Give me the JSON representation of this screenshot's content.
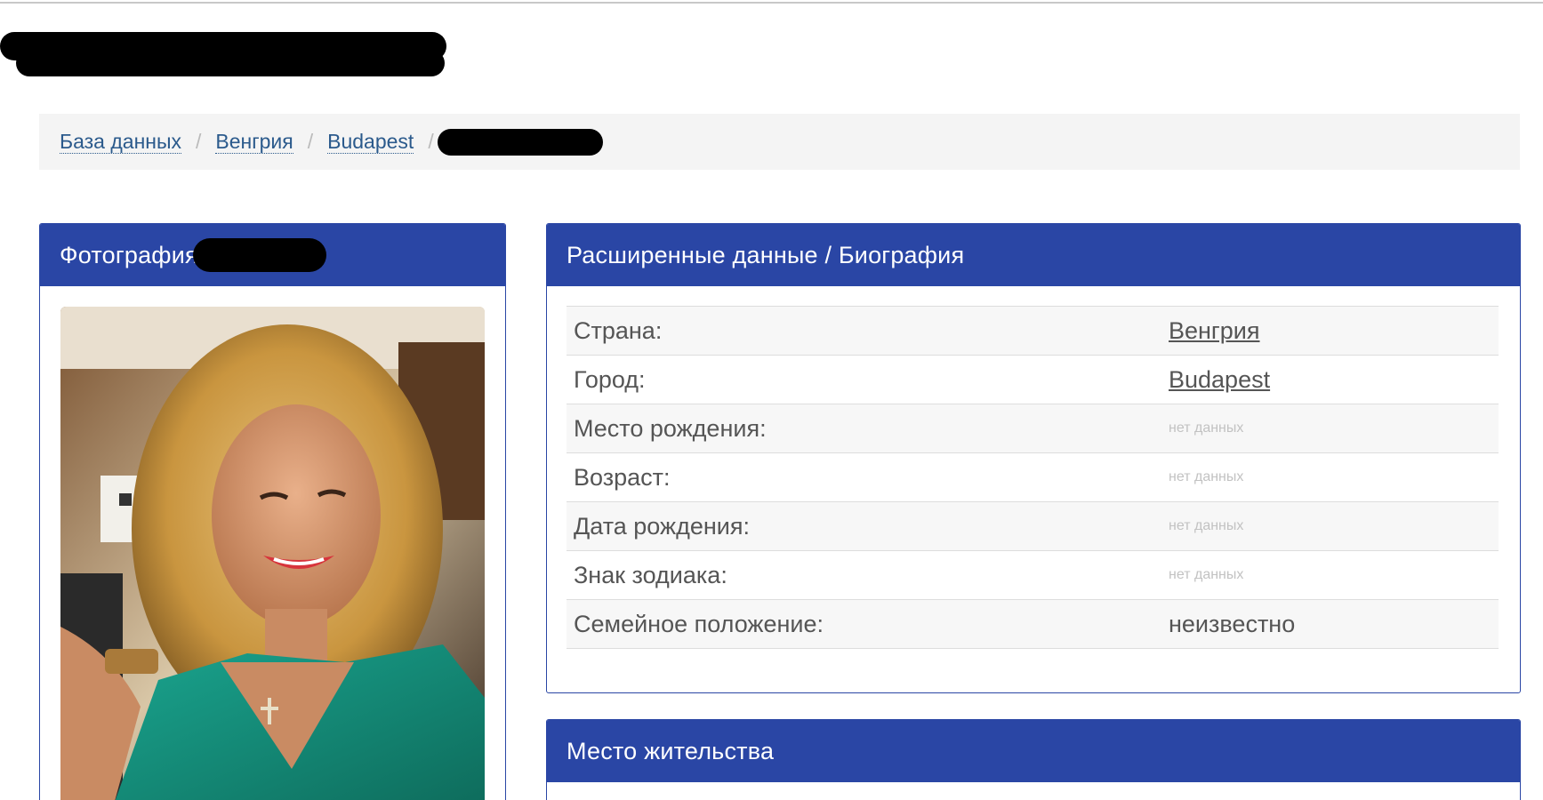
{
  "breadcrumb": {
    "items": [
      "База данных",
      "Венгрия",
      "Budapest"
    ],
    "separator": "/"
  },
  "photo_panel": {
    "title": "Фотография"
  },
  "bio_panel": {
    "title": "Расширенные данные / Биография",
    "rows": [
      {
        "label": "Страна:",
        "value": "Венгрия"
      },
      {
        "label": "Город:",
        "value": "Budapest"
      },
      {
        "label": "Место рождения:",
        "value": "нет данных"
      },
      {
        "label": "Возраст:",
        "value": "нет данных"
      },
      {
        "label": "Дата рождения:",
        "value": "нет данных"
      },
      {
        "label": "Знак зодиака:",
        "value": "нет данных"
      },
      {
        "label": "Семейное положение:",
        "value": "неизвестно"
      }
    ]
  },
  "residence_panel": {
    "title": "Место жительства"
  },
  "colors": {
    "panel_header": "#2a46a5",
    "breadcrumb_link": "#2b5a8c",
    "breadcrumb_bg": "#f4f4f4"
  }
}
